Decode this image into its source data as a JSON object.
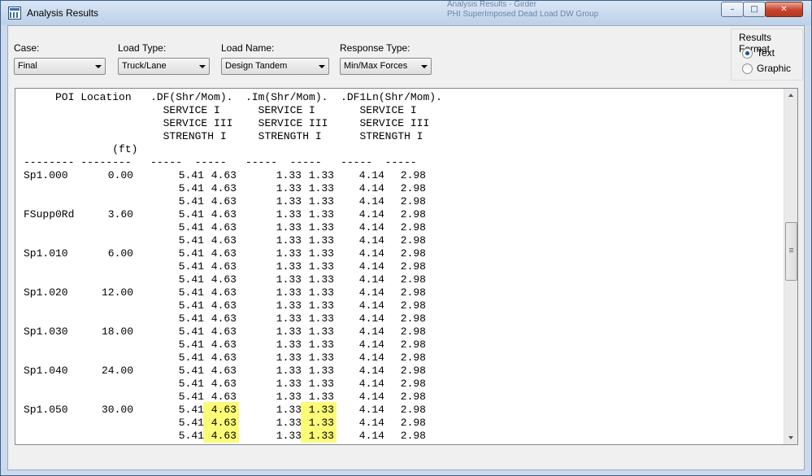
{
  "window": {
    "title": "Analysis Results",
    "icon": "grid-table-icon",
    "background_titles": [
      "Analysis Results - Girder",
      "PHI SuperImposed Dead Load DW Group"
    ],
    "minimize_symbol": "–",
    "maximize_symbol": "□",
    "close_symbol": "✕"
  },
  "controls": {
    "case": {
      "label": "Case:",
      "value": "Final"
    },
    "load_type": {
      "label": "Load Type:",
      "value": "Truck/Lane"
    },
    "load_name": {
      "label": "Load Name:",
      "value": "Design Tandem"
    },
    "response_type": {
      "label": "Response Type:",
      "value": "Min/Max Forces"
    },
    "results_format": {
      "label": "Results Format",
      "options": [
        {
          "label": "Text",
          "checked": true
        },
        {
          "label": "Graphic",
          "checked": false
        }
      ]
    }
  },
  "report": {
    "header_lines": [
      "     POI Location   .DF(Shr/Mom).  .Im(Shr/Mom).  .DF1Ln(Shr/Mom).",
      "                      SERVICE I      SERVICE I       SERVICE I",
      "                      SERVICE III    SERVICE III     SERVICE III",
      "                      STRENGTH I     STRENGTH I      STRENGTH I",
      "              (ft)",
      "-------- --------   -----  -----   -----  -----   -----  -----"
    ],
    "rows": [
      {
        "poi": "Sp1.000",
        "loc": "0.00",
        "values": [
          [
            "5.41",
            "4.63",
            "1.33",
            "1.33",
            "4.14",
            "2.98"
          ],
          [
            "5.41",
            "4.63",
            "1.33",
            "1.33",
            "4.14",
            "2.98"
          ],
          [
            "5.41",
            "4.63",
            "1.33",
            "1.33",
            "4.14",
            "2.98"
          ]
        ]
      },
      {
        "poi": "FSupp0Rd",
        "loc": "3.60",
        "values": [
          [
            "5.41",
            "4.63",
            "1.33",
            "1.33",
            "4.14",
            "2.98"
          ],
          [
            "5.41",
            "4.63",
            "1.33",
            "1.33",
            "4.14",
            "2.98"
          ],
          [
            "5.41",
            "4.63",
            "1.33",
            "1.33",
            "4.14",
            "2.98"
          ]
        ]
      },
      {
        "poi": "Sp1.010",
        "loc": "6.00",
        "values": [
          [
            "5.41",
            "4.63",
            "1.33",
            "1.33",
            "4.14",
            "2.98"
          ],
          [
            "5.41",
            "4.63",
            "1.33",
            "1.33",
            "4.14",
            "2.98"
          ],
          [
            "5.41",
            "4.63",
            "1.33",
            "1.33",
            "4.14",
            "2.98"
          ]
        ]
      },
      {
        "poi": "Sp1.020",
        "loc": "12.00",
        "values": [
          [
            "5.41",
            "4.63",
            "1.33",
            "1.33",
            "4.14",
            "2.98"
          ],
          [
            "5.41",
            "4.63",
            "1.33",
            "1.33",
            "4.14",
            "2.98"
          ],
          [
            "5.41",
            "4.63",
            "1.33",
            "1.33",
            "4.14",
            "2.98"
          ]
        ]
      },
      {
        "poi": "Sp1.030",
        "loc": "18.00",
        "values": [
          [
            "5.41",
            "4.63",
            "1.33",
            "1.33",
            "4.14",
            "2.98"
          ],
          [
            "5.41",
            "4.63",
            "1.33",
            "1.33",
            "4.14",
            "2.98"
          ],
          [
            "5.41",
            "4.63",
            "1.33",
            "1.33",
            "4.14",
            "2.98"
          ]
        ]
      },
      {
        "poi": "Sp1.040",
        "loc": "24.00",
        "values": [
          [
            "5.41",
            "4.63",
            "1.33",
            "1.33",
            "4.14",
            "2.98"
          ],
          [
            "5.41",
            "4.63",
            "1.33",
            "1.33",
            "4.14",
            "2.98"
          ],
          [
            "5.41",
            "4.63",
            "1.33",
            "1.33",
            "4.14",
            "2.98"
          ]
        ]
      },
      {
        "poi": "Sp1.050",
        "loc": "30.00",
        "values": [
          [
            "5.41",
            "4.63",
            "1.33",
            "1.33",
            "4.14",
            "2.98"
          ],
          [
            "5.41",
            "4.63",
            "1.33",
            "1.33",
            "4.14",
            "2.98"
          ],
          [
            "5.41",
            "4.63",
            "1.33",
            "1.33",
            "4.14",
            "2.98"
          ]
        ]
      }
    ],
    "highlight_color": "#fbfb78",
    "highlighted": {
      "row_group": 6,
      "columns": [
        1,
        3
      ]
    }
  }
}
